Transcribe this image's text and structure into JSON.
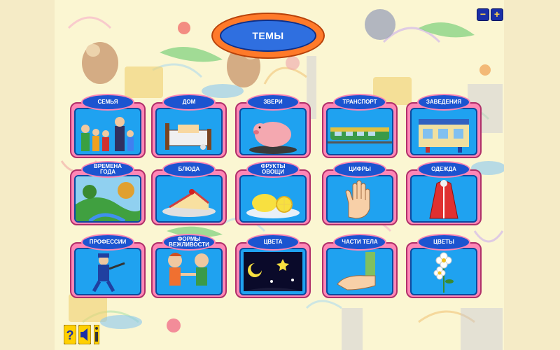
{
  "app": {
    "title": "ТЕМЫ"
  },
  "zoom": {
    "minus_label": "−",
    "plus_label": "+"
  },
  "themes": [
    {
      "label": "СЕМЬЯ",
      "icon": "family-icon"
    },
    {
      "label": "ДОМ",
      "icon": "bed-icon"
    },
    {
      "label": "ЗВЕРИ",
      "icon": "pig-icon"
    },
    {
      "label": "ТРАНСПОРТ",
      "icon": "train-icon"
    },
    {
      "label": "ЗАВЕДЕНИЯ",
      "icon": "building-icon"
    },
    {
      "label": "ВРЕМЕНА\nГОДА",
      "icon": "landscape-icon"
    },
    {
      "label": "БЛЮДА",
      "icon": "cake-icon"
    },
    {
      "label": "ФРУКТЫ\nОВОЩИ",
      "icon": "lemon-icon"
    },
    {
      "label": "ЦИФРЫ",
      "icon": "hand-icon"
    },
    {
      "label": "ОДЕЖДА",
      "icon": "coat-icon"
    },
    {
      "label": "ПРОФЕССИИ",
      "icon": "police-icon"
    },
    {
      "label": "ФОРМЫ\nВЕЖЛИВОСТИ",
      "icon": "people-greeting-icon"
    },
    {
      "label": "ЦВЕТА",
      "icon": "night-sky-icon"
    },
    {
      "label": "ЧАСТИ ТЕЛА",
      "icon": "arm-icon"
    },
    {
      "label": "ЦВЕТЫ",
      "icon": "daisy-icon"
    }
  ],
  "bottom": {
    "help_label": "?",
    "info_label": "i"
  },
  "colors": {
    "frame_pink": "#ff86b6",
    "panel_blue": "#1fa2f0",
    "label_blue": "#1c54d0",
    "title_orange": "#ff7a2a",
    "background": "#fbf6d2"
  }
}
